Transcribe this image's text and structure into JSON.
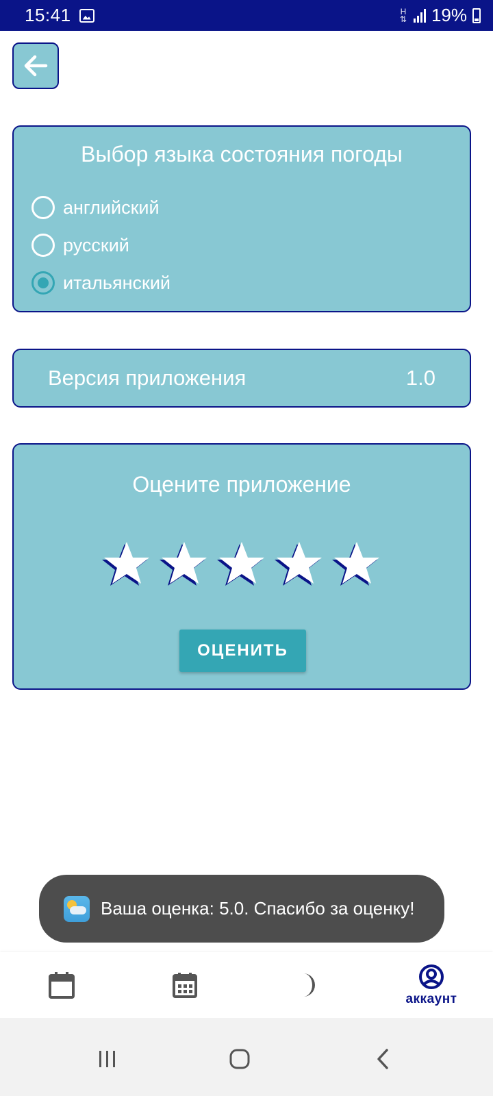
{
  "status_bar": {
    "time": "15:41",
    "network": "H",
    "battery": "19%",
    "icons": [
      "gallery-icon",
      "network-h-icon",
      "signal-icon",
      "battery-icon"
    ]
  },
  "back_button": {
    "icon": "arrow-left-icon"
  },
  "language_card": {
    "title": "Выбор языка состояния погоды",
    "options": [
      {
        "label": "английский",
        "checked": false
      },
      {
        "label": "русский",
        "checked": false
      },
      {
        "label": "итальянский",
        "checked": true
      }
    ]
  },
  "version_card": {
    "label": "Версия приложения",
    "value": "1.0"
  },
  "rate_card": {
    "title": "Оцените приложение",
    "rating": 5,
    "max_rating": 5,
    "button_label": "ОЦЕНИТЬ"
  },
  "toast": {
    "icon": "weather-app-icon",
    "text": "Ваша оценка: 5.0. Спасибо за оценку!"
  },
  "bottom_nav": {
    "items": [
      {
        "icon": "calendar-icon",
        "label": ""
      },
      {
        "icon": "calendar-grid-icon",
        "label": ""
      },
      {
        "icon": "moon-icon",
        "label": ""
      },
      {
        "icon": "account-circle-icon",
        "label": "аккаунт",
        "active": true
      }
    ]
  },
  "colors": {
    "primary_dark": "#0a1488",
    "card_bg": "#88c8d3",
    "accent": "#34a6b4",
    "toast_bg": "#4d4d4d"
  }
}
